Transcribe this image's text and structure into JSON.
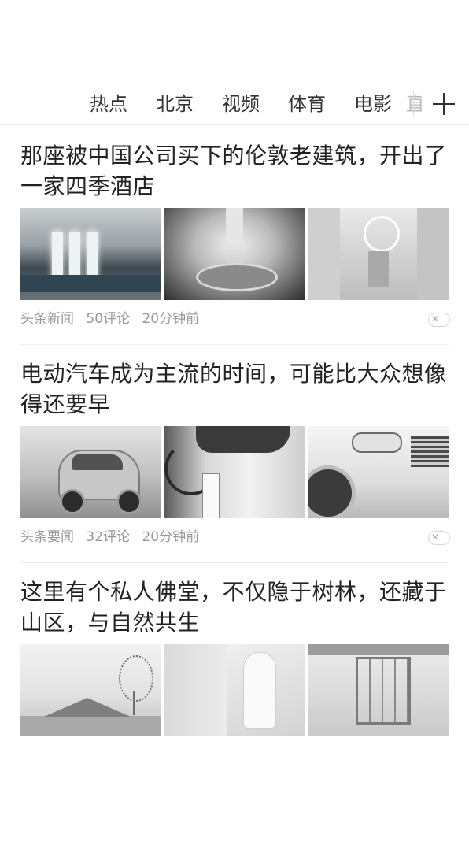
{
  "tabs": {
    "items": [
      "热点",
      "北京",
      "视频",
      "体育",
      "电影"
    ],
    "partial_item": "直"
  },
  "feed": {
    "articles": [
      {
        "title": "那座被中国公司买下的伦敦老建筑，开出了一家四季酒店",
        "source": "头条新闻",
        "comments": "50评论",
        "time": "20分钟前",
        "thumbs": [
          "spa-pool-photo",
          "spa-fountain-photo",
          "hotel-atrium-photo"
        ]
      },
      {
        "title": "电动汽车成为主流的时间，可能比大众想像得还要早",
        "source": "头条要闻",
        "comments": "32评论",
        "time": "20分钟前",
        "thumbs": [
          "smart-car-photo",
          "charging-station-photo",
          "car-headlight-photo"
        ]
      },
      {
        "title": "这里有个私人佛堂，不仅隐于树林，还藏于山区，与自然共生",
        "thumbs": [
          "glass-roof-building-photo",
          "buddha-statue-photo",
          "courtyard-interior-photo"
        ]
      }
    ],
    "dismiss_icon": "close-icon"
  }
}
